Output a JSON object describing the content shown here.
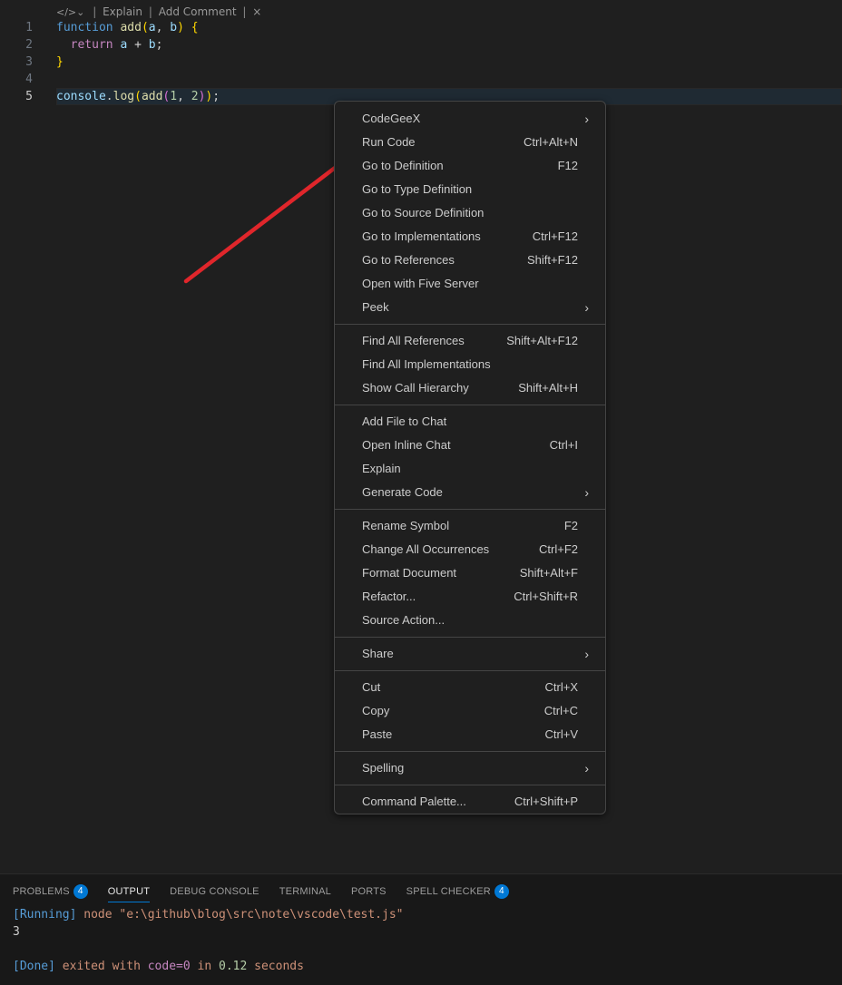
{
  "codelens": {
    "icon": "code-icon",
    "chevron": "chevron-down-icon",
    "explain": "Explain",
    "add_comment": "Add Comment",
    "close": "×"
  },
  "editor": {
    "lines": [
      {
        "number": "1",
        "tokens": [
          [
            "function",
            "tk-kw"
          ],
          [
            " ",
            "tk-pl"
          ],
          [
            "add",
            "tk-fn"
          ],
          [
            "(",
            "tk-p1"
          ],
          [
            "a",
            "tk-var"
          ],
          [
            ", ",
            "tk-pl"
          ],
          [
            "b",
            "tk-var"
          ],
          [
            ")",
            "tk-p1"
          ],
          [
            " ",
            "tk-pl"
          ],
          [
            "{",
            "tk-p1"
          ]
        ]
      },
      {
        "number": "2",
        "tokens": [
          [
            "  ",
            "tk-pl"
          ],
          [
            "return",
            "tk-ctl"
          ],
          [
            " ",
            "tk-pl"
          ],
          [
            "a",
            "tk-var"
          ],
          [
            " + ",
            "tk-op"
          ],
          [
            "b",
            "tk-var"
          ],
          [
            ";",
            "tk-pl"
          ]
        ]
      },
      {
        "number": "3",
        "tokens": [
          [
            "}",
            "tk-p1"
          ]
        ]
      },
      {
        "number": "4",
        "tokens": []
      },
      {
        "number": "5",
        "tokens": [
          [
            "console",
            "tk-var"
          ],
          [
            ".",
            "tk-pl"
          ],
          [
            "log",
            "tk-fn"
          ],
          [
            "(",
            "tk-p1"
          ],
          [
            "add",
            "tk-fn"
          ],
          [
            "(",
            "tk-p2"
          ],
          [
            "1",
            "tk-num"
          ],
          [
            ", ",
            "tk-pl"
          ],
          [
            "2",
            "tk-num"
          ],
          [
            ")",
            "tk-p2"
          ],
          [
            ")",
            "tk-p1"
          ],
          [
            ";",
            "tk-pl"
          ]
        ],
        "current": true
      }
    ]
  },
  "context_menu": {
    "groups": [
      [
        {
          "label": "CodeGeeX",
          "submenu": true
        },
        {
          "label": "Run Code",
          "shortcut": "Ctrl+Alt+N"
        },
        {
          "label": "Go to Definition",
          "shortcut": "F12"
        },
        {
          "label": "Go to Type Definition"
        },
        {
          "label": "Go to Source Definition"
        },
        {
          "label": "Go to Implementations",
          "shortcut": "Ctrl+F12"
        },
        {
          "label": "Go to References",
          "shortcut": "Shift+F12"
        },
        {
          "label": "Open with Five Server"
        },
        {
          "label": "Peek",
          "submenu": true
        }
      ],
      [
        {
          "label": "Find All References",
          "shortcut": "Shift+Alt+F12"
        },
        {
          "label": "Find All Implementations"
        },
        {
          "label": "Show Call Hierarchy",
          "shortcut": "Shift+Alt+H"
        }
      ],
      [
        {
          "label": "Add File to Chat"
        },
        {
          "label": "Open Inline Chat",
          "shortcut": "Ctrl+I"
        },
        {
          "label": "Explain"
        },
        {
          "label": "Generate Code",
          "submenu": true
        }
      ],
      [
        {
          "label": "Rename Symbol",
          "shortcut": "F2"
        },
        {
          "label": "Change All Occurrences",
          "shortcut": "Ctrl+F2"
        },
        {
          "label": "Format Document",
          "shortcut": "Shift+Alt+F"
        },
        {
          "label": "Refactor...",
          "shortcut": "Ctrl+Shift+R"
        },
        {
          "label": "Source Action..."
        }
      ],
      [
        {
          "label": "Share",
          "submenu": true
        }
      ],
      [
        {
          "label": "Cut",
          "shortcut": "Ctrl+X"
        },
        {
          "label": "Copy",
          "shortcut": "Ctrl+C"
        },
        {
          "label": "Paste",
          "shortcut": "Ctrl+V"
        }
      ],
      [
        {
          "label": "Spelling",
          "submenu": true
        }
      ],
      [
        {
          "label": "Command Palette...",
          "shortcut": "Ctrl+Shift+P"
        }
      ]
    ]
  },
  "annotation": {
    "color": "#e0262b"
  },
  "panel": {
    "tabs": [
      {
        "label": "PROBLEMS",
        "badge": "4"
      },
      {
        "label": "OUTPUT",
        "active": true
      },
      {
        "label": "DEBUG CONSOLE"
      },
      {
        "label": "TERMINAL"
      },
      {
        "label": "PORTS"
      },
      {
        "label": "SPELL CHECKER",
        "badge": "4"
      }
    ],
    "output": {
      "running_tag": "[Running]",
      "running_cmd": "node \"e:\\github\\blog\\src\\note\\vscode\\test.js\"",
      "result": "3",
      "done_tag": "[Done]",
      "done_1": "exited with",
      "done_code": "code=0",
      "done_2": "in",
      "done_time": "0.12",
      "done_3": "seconds"
    }
  }
}
